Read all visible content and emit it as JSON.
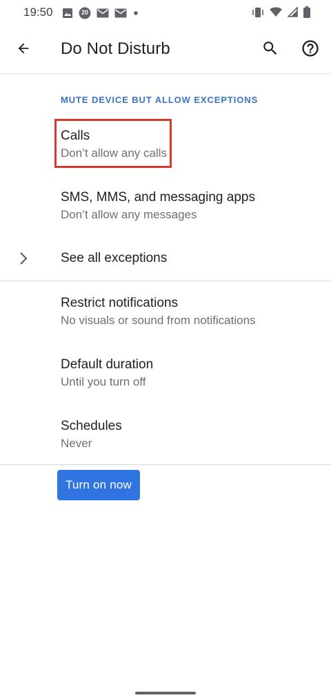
{
  "status_bar": {
    "time": "19:50",
    "left_icons": [
      "image-icon",
      "badge-20-icon",
      "mail-icon",
      "mail-icon",
      "dot-icon"
    ],
    "badge_text": "20",
    "right_icons": [
      "vibrate-icon",
      "wifi-icon",
      "signal-icon",
      "battery-icon"
    ]
  },
  "app_bar": {
    "title": "Do Not Disturb",
    "back_icon": "arrow-back-icon",
    "search_icon": "search-icon",
    "help_icon": "help-icon"
  },
  "section": {
    "header": "MUTE DEVICE BUT ALLOW EXCEPTIONS"
  },
  "items": [
    {
      "title": "Calls",
      "subtitle": "Don’t allow any calls",
      "highlighted": true
    },
    {
      "title": "SMS, MMS, and messaging apps",
      "subtitle": "Don’t allow any messages"
    },
    {
      "title": "See all exceptions",
      "icon": "chevron-right-icon"
    },
    {
      "title": "Restrict notifications",
      "subtitle": "No visuals or sound from notifications"
    },
    {
      "title": "Default duration",
      "subtitle": "Until you turn off"
    },
    {
      "title": "Schedules",
      "subtitle": "Never"
    }
  ],
  "button": {
    "label": "Turn on now"
  },
  "colors": {
    "accent": "#2f74e0",
    "section_header": "#3b74c7",
    "highlight_box": "#d63a2b"
  }
}
